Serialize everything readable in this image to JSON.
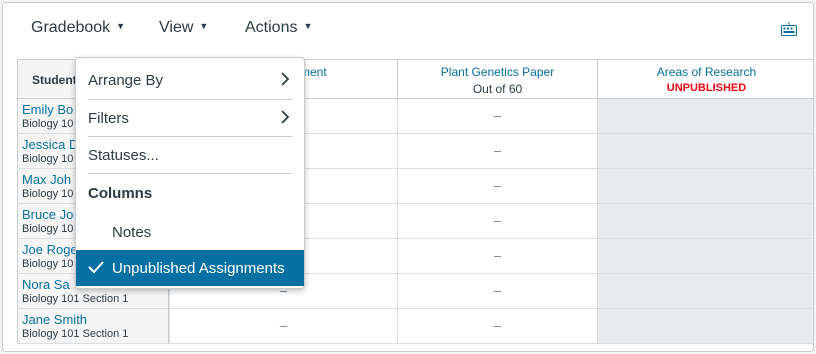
{
  "toolbar": {
    "gradebook": "Gradebook",
    "view": "View",
    "actions": "Actions",
    "caret": "▼"
  },
  "columns": [
    {
      "title": "ment",
      "sub": ""
    },
    {
      "title": "Plant Genetics Paper",
      "sub": "Out of 60"
    },
    {
      "title": "Areas of Research",
      "badge": "UNPUBLISHED"
    }
  ],
  "student_header": "Student",
  "rows": [
    {
      "name": "Emily Bo",
      "section": "Biology 10",
      "grade": "–"
    },
    {
      "name": "Jessica D",
      "section": "Biology 10",
      "grade": "–"
    },
    {
      "name": "Max Joh",
      "section": "Biology 10",
      "grade": "–"
    },
    {
      "name": "Bruce Jo",
      "section": "Biology 10",
      "grade": "–"
    },
    {
      "name": "Joe Roge",
      "section": "Biology 10",
      "grade": "–"
    },
    {
      "name": "Nora Sa",
      "section": "Biology 101 Section 1",
      "grade": "–"
    },
    {
      "name": "Jane Smith",
      "section": "Biology 101 Section 1",
      "grade": "–"
    }
  ],
  "partial_grade": "–",
  "menu": {
    "arrange_by": "Arrange By",
    "filters": "Filters",
    "statuses": "Statuses...",
    "columns_header": "Columns",
    "notes": "Notes",
    "unpublished": "Unpublished Assignments"
  },
  "colors": {
    "link": "#0770a3",
    "selected_bg": "#0770a3",
    "unpublished": "#ee0612"
  }
}
